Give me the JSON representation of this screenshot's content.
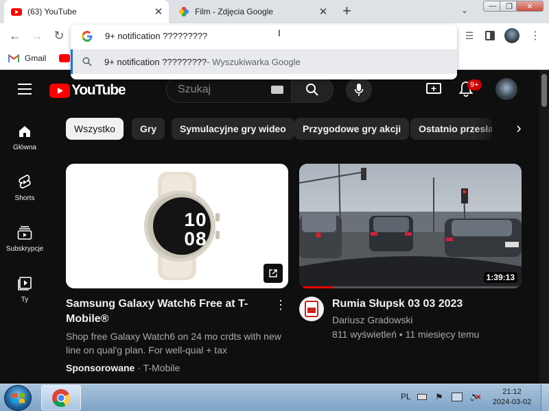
{
  "tabs": [
    {
      "title": "(63) YouTube",
      "active": true
    },
    {
      "title": "Film - Zdjęcia Google",
      "active": false
    }
  ],
  "window_controls": {
    "minimize": "—",
    "maximize": "❐",
    "close": "✕"
  },
  "omnibox": {
    "query": "9+ notification ?????????",
    "suggestion_text": "9+ notification ?????????",
    "suggestion_source": " - Wyszukiwarka Google"
  },
  "bookmarks": [
    {
      "label": "Gmail"
    }
  ],
  "youtube": {
    "logo": "YouTube",
    "search_placeholder": "Szukaj",
    "notification_badge": "9+",
    "sidebar": [
      {
        "label": "Główna",
        "icon": "home-icon"
      },
      {
        "label": "Shorts",
        "icon": "shorts-icon"
      },
      {
        "label": "Subskrypcje",
        "icon": "subscriptions-icon"
      },
      {
        "label": "Ty",
        "icon": "you-icon"
      }
    ],
    "chips": [
      "Wszystko",
      "Gry",
      "Symulacyjne gry wideo",
      "Przygodowe gry akcji",
      "Ostatnio przesłane"
    ],
    "videos": [
      {
        "title": "Samsung Galaxy Watch6 Free at T-Mobile®",
        "description": "Shop free Galaxy Watch6 on 24 mo crdts with new line on qual'g plan. For well-qual + tax",
        "sponsored_label": "Sponsorowane",
        "advertiser": " · T-Mobile",
        "watch_face": "10 08"
      },
      {
        "title": "Rumia Słupsk 03 03 2023",
        "channel": "Dariusz Gradowski",
        "meta": "811 wyświetleń • 11 miesięcy temu",
        "duration": "1:39:13",
        "watched_fraction": 0.15
      }
    ]
  },
  "taskbar": {
    "language": "PL",
    "time": "21:12",
    "date": "2024-03-02"
  },
  "colors": {
    "yt_red": "#ff0000",
    "yt_bg": "#0f0f0f",
    "chrome_blue": "#1a73e8"
  }
}
